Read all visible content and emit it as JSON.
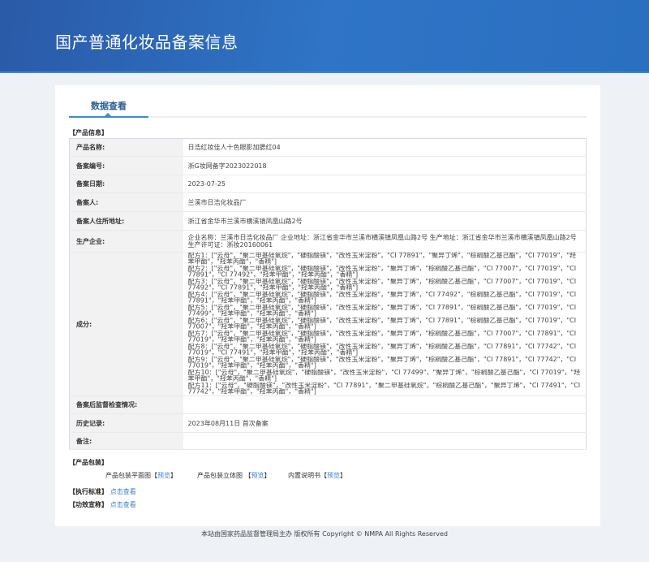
{
  "header": {
    "title": "国产普通化妆品备案信息"
  },
  "tab": {
    "label": "数据查看"
  },
  "sections": {
    "product_info": "【产品信息】",
    "packaging": "【产品包装】",
    "standard": "【执行标准】",
    "efficacy": "【功效宣称】"
  },
  "rows": [
    {
      "label": "产品名称:",
      "value": "日浩红妆佳人十色眼影加腮红04"
    },
    {
      "label": "备案编号:",
      "value": "浙G妆网备字2023022018"
    },
    {
      "label": "备案日期:",
      "value": "2023-07-25"
    },
    {
      "label": "备案人:",
      "value": "兰溪市日浩化妆品厂"
    },
    {
      "label": "备案人住所地址:",
      "value": "浙江省金华市兰溪市横溪镇凤凰山路2号"
    },
    {
      "label": "生产企业:",
      "value": "企业名称：兰溪市日浩化妆品厂 企业地址：浙江省金华市兰溪市横溪镇凤凰山路2号 生产地址：浙江省金华市兰溪市横溪镇凤凰山路2号 生产许可证：浙妆20160061"
    }
  ],
  "ingredients": {
    "label": "成分:",
    "formulas": [
      "配方1：[\"云母\"，\"聚二甲基硅氧烷\"，\"硬脂酸镁\"，\"改性玉米淀粉\"，\"CI 77891\"，\"聚异丁烯\"，\"棕榈酸乙基己酯\"，\"CI 77019\"，\"羟苯甲酯\"，\"羟苯丙酯\"，\"香精\"]",
      "配方2：[\"云母\"，\"聚二甲基硅氧烷\"，\"硬脂酸镁\"，\"改性玉米淀粉\"，\"聚异丁烯\"，\"棕榈酸乙基己酯\"，\"CI 77007\"，\"CI 77019\"，\"CI 77891\"，\"CI 77492\"，\"羟苯甲酯\"，\"羟苯丙酯\"，\"香精\"]",
      "配方3：[\"云母\"，\"聚二甲基硅氧烷\"，\"硬脂酸镁\"，\"改性玉米淀粉\"，\"聚异丁烯\"，\"棕榈酸乙基己酯\"，\"CI 77007\"，\"CI 77019\"，\"CI 77492\"，\"CI 77891\"，\"羟苯甲酯\"，\"羟苯丙酯\"，\"香精\"]",
      "配方4：[\"云母\"，\"聚二甲基硅氧烷\"，\"硬脂酸镁\"，\"改性玉米淀粉\"，\"聚异丁烯\"，\"CI 77492\"，\"棕榈酸乙基己酯\"，\"CI 77019\"，\"CI 77891\"，\"羟苯甲酯\"，\"羟苯丙酯\"，\"香精\"]",
      "配方5：[\"云母\"，\"聚二甲基硅氧烷\"，\"硬脂酸镁\"，\"改性玉米淀粉\"，\"聚异丁烯\"，\"CI 77891\"，\"棕榈酸乙基己酯\"，\"CI 77019\"，\"CI 77499\"，\"羟苯甲酯\"，\"羟苯丙酯\"，\"香精\"]",
      "配方6：[\"云母\"，\"聚二甲基硅氧烷\"，\"硬脂酸镁\"，\"改性玉米淀粉\"，\"聚异丁烯\"，\"CI 77891\"，\"棕榈酸乙基己酯\"，\"CI 77019\"，\"CI 77007\"，\"羟苯甲酯\"，\"羟苯丙酯\"，\"香精\"]",
      "配方7：[\"云母\"，\"聚二甲基硅氧烷\"，\"硬脂酸镁\"，\"改性玉米淀粉\"，\"聚异丁烯\"，\"棕榈酸乙基己酯\"，\"CI 77007\"，\"CI 77891\"，\"CI 77019\"，\"羟苯甲酯\"，\"羟苯丙酯\"，\"香精\"]",
      "配方8：[\"云母\"，\"聚二甲基硅氧烷\"，\"硬脂酸镁\"，\"改性玉米淀粉\"，\"聚异丁烯\"，\"棕榈酸乙基己酯\"，\"CI 77891\"，\"CI 77742\"，\"CI 77019\"，\"CI 77491\"，\"羟苯甲酯\"，\"羟苯丙酯\"，\"香精\"]",
      "配方9：[\"云母\"，\"聚二甲基硅氧烷\"，\"硬脂酸镁\"，\"改性玉米淀粉\"，\"聚异丁烯\"，\"棕榈酸乙基己酯\"，\"CI 77891\"，\"CI 77742\"，\"CI 77019\"，\"羟苯甲酯\"，\"羟苯丙酯\"，\"香精\"]",
      "配方10：[\"云母\"，\"聚二甲基硅氧烷\"，\"硬脂酸镁\"，\"改性玉米淀粉\"，\"CI 77499\"，\"聚异丁烯\"，\"棕榈酸乙基己酯\"，\"CI 77019\"，\"羟苯甲酯\"，\"羟苯丙酯\"，\"香精\"]",
      "配方11：[\"云母\"，\"硬脂酸镁\"，\"改性玉米淀粉\"，\"CI 77891\"，\"聚二甲基硅氧烷\"，\"棕榈酸乙基己酯\"，\"聚异丁烯\"，\"CI 77491\"，\"CI 77742\"，\"羟苯甲酯\"，\"羟苯丙酯\"，\"香精\"]"
    ]
  },
  "rows2": [
    {
      "label": "备案后监督检查情况:",
      "value": ""
    },
    {
      "label": "历史记录:",
      "value": "2023年08月11日 首次备案"
    },
    {
      "label": "备注:",
      "value": ""
    }
  ],
  "packaging": {
    "items": [
      {
        "label": "产品包装平面图",
        "link": "预览"
      },
      {
        "label": "产品包装立体图",
        "link": "预览"
      },
      {
        "label": "内置说明书",
        "link": "预览"
      }
    ],
    "open": "【",
    "close": "】"
  },
  "links": {
    "standard": "点击查看",
    "efficacy": "点击查看"
  },
  "footer": {
    "text": "本站由国家药品监督管理局主办 版权所有 Copyright © NMPA All Rights Reserved"
  }
}
